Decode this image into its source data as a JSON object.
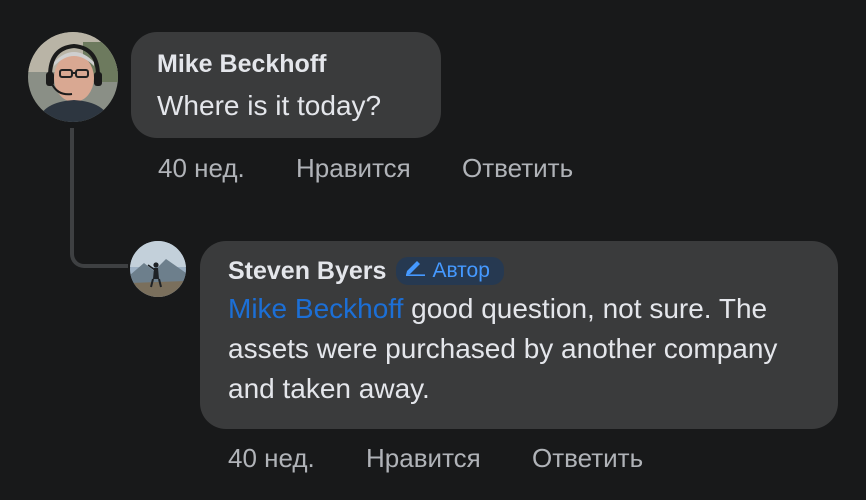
{
  "comment": {
    "author": "Mike Beckhoff",
    "text": "Where is it today?",
    "time": "40 нед.",
    "like_label": "Нравится",
    "reply_label": "Ответить",
    "avatar_icon": "avatar-man-with-headset"
  },
  "reply": {
    "author": "Steven Byers",
    "badge_label": "Автор",
    "badge_icon": "pencil-icon",
    "mention": "Mike Beckhoff",
    "text": " good question, not sure. The assets were purchased by another company and taken away.",
    "time": "40 нед.",
    "like_label": "Нравится",
    "reply_label": "Ответить",
    "avatar_icon": "avatar-person-mountain"
  },
  "colors": {
    "background": "#18191a",
    "bubble": "#3a3b3c",
    "text": "#e4e6eb",
    "secondary_text": "#b0b3b8",
    "mention": "#1c6fd6",
    "badge_bg": "#263951",
    "badge_text": "#4599ff"
  }
}
